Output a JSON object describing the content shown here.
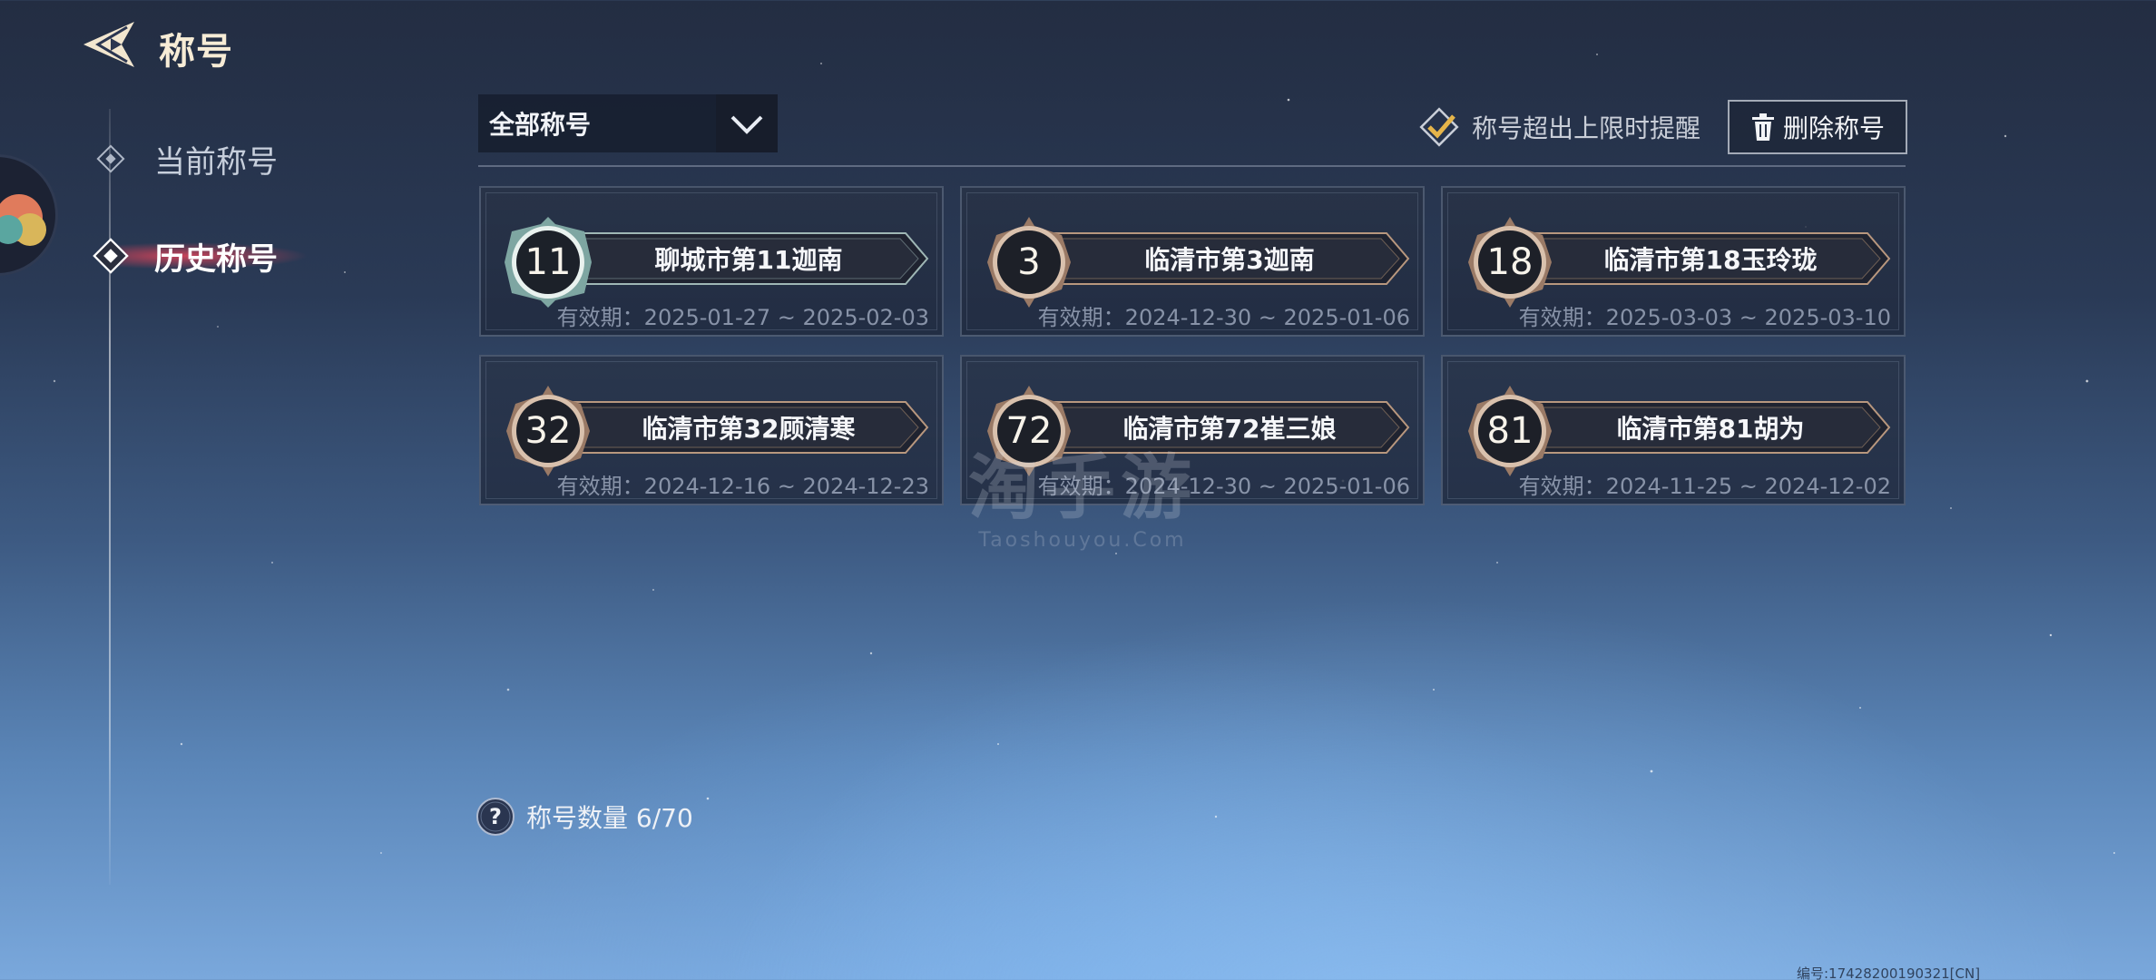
{
  "header": {
    "title": "称号"
  },
  "nav": {
    "items": [
      {
        "label": "当前称号",
        "active": false
      },
      {
        "label": "历史称号",
        "active": true
      }
    ]
  },
  "filter": {
    "selected": "全部称号"
  },
  "reminder": {
    "label": "称号超出上限时提醒",
    "checked": true
  },
  "delete_button": {
    "label": "删除称号"
  },
  "titles": [
    {
      "rank": "11",
      "name": "聊城市第11迦南",
      "validity": "有效期：2025-01-27 ~ 2025-02-03",
      "tier": "silver"
    },
    {
      "rank": "3",
      "name": "临清市第3迦南",
      "validity": "有效期：2024-12-30 ~ 2025-01-06",
      "tier": "bronze"
    },
    {
      "rank": "18",
      "name": "临清市第18玉玲珑",
      "validity": "有效期：2025-03-03 ~ 2025-03-10",
      "tier": "bronze"
    },
    {
      "rank": "32",
      "name": "临清市第32顾清寒",
      "validity": "有效期：2024-12-16 ~ 2024-12-23",
      "tier": "bronze"
    },
    {
      "rank": "72",
      "name": "临清市第72崔三娘",
      "validity": "有效期：2024-12-30 ~ 2025-01-06",
      "tier": "bronze"
    },
    {
      "rank": "81",
      "name": "临清市第81胡为",
      "validity": "有效期：2024-11-25 ~ 2024-12-02",
      "tier": "bronze"
    }
  ],
  "count": {
    "label": "称号数量 6/70"
  },
  "watermark": {
    "main": "淘手游",
    "sub": "Taoshouyou.Com"
  },
  "footer": {
    "serial": "编号:17428200190321[CN]"
  },
  "colors": {
    "silver_rim": "#a9d1cc",
    "bronze_rim": "#b8977e",
    "accent_check": "#e6b54a",
    "nav_glow": "#ff465a"
  }
}
